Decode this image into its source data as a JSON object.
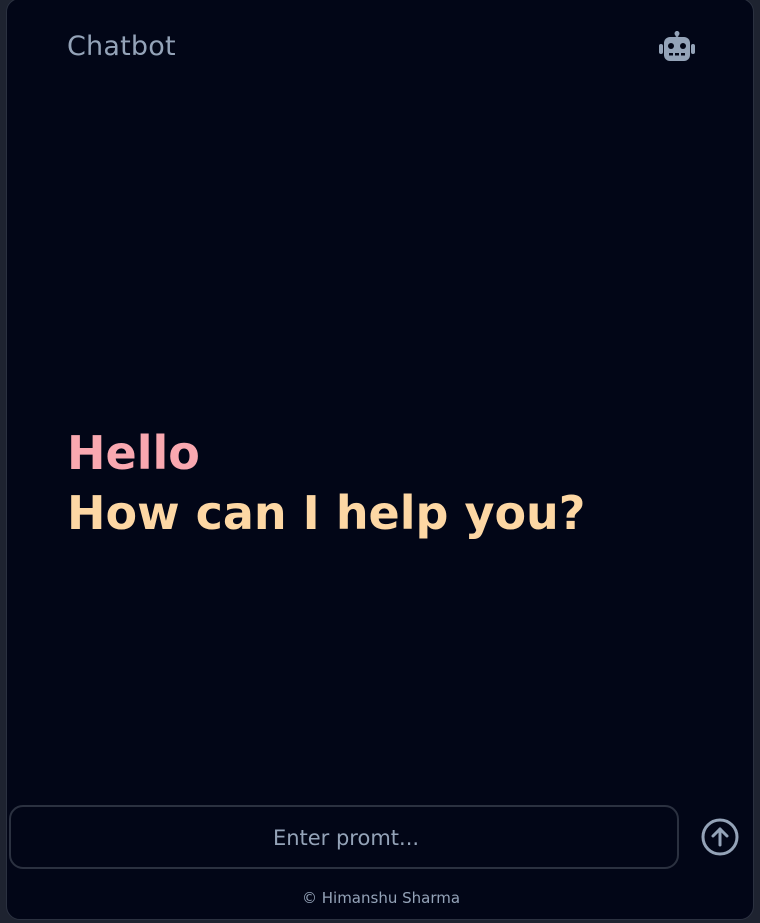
{
  "header": {
    "title": "Chatbot",
    "icon": "robot-icon"
  },
  "greeting": {
    "hello": "Hello",
    "question": "How can I help you?"
  },
  "prompt": {
    "placeholder": "Enter promt...",
    "value": "",
    "send_icon": "arrow-up-circle-icon"
  },
  "footer": {
    "copyright_symbol": "©",
    "author": "Himanshu Sharma"
  },
  "colors": {
    "background": "#020617",
    "muted_text": "#94a3b8",
    "hello": "#f9a8b0",
    "question": "#fdd7a4"
  }
}
